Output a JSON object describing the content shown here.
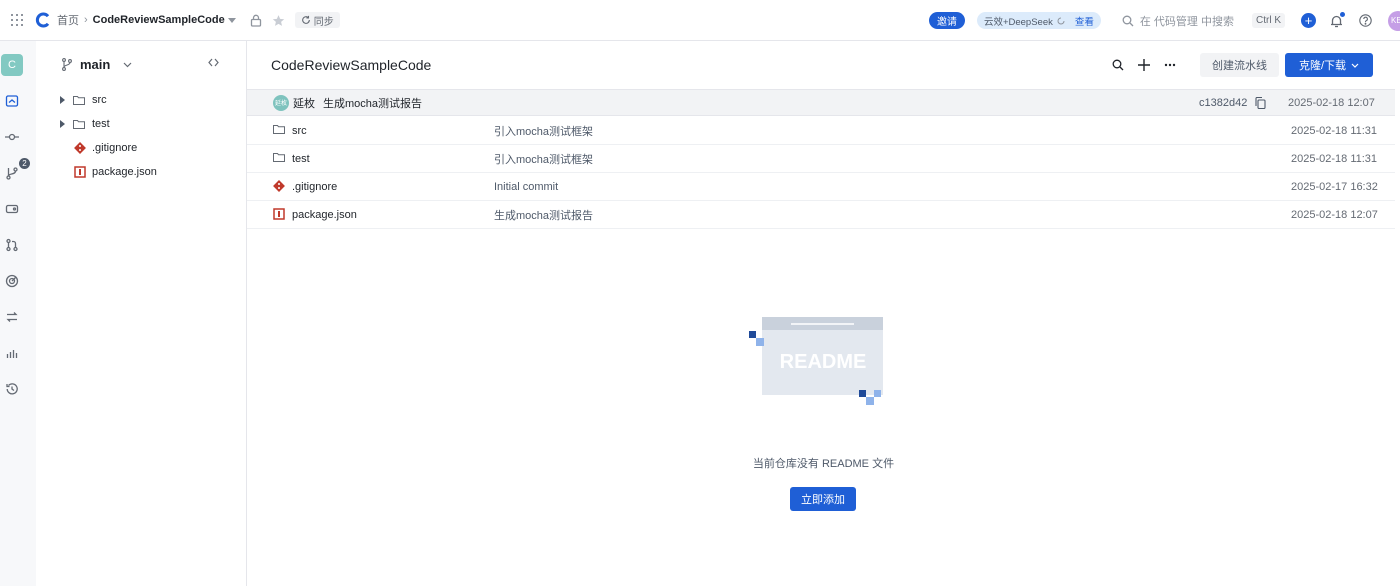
{
  "topbar": {
    "home": "首页",
    "repo": "CodeReviewSampleCode",
    "sync": "同步",
    "invite": "邀请",
    "ai_label": "云效+DeepSeek",
    "ai_view": "查看",
    "search_placeholder": "在 代码管理 中搜索",
    "shortcut": "Ctrl K",
    "avatar": "KE",
    "accent": "#1f5fd6"
  },
  "rail": {
    "repo_initial": "C",
    "merge_badge": "2",
    "icons": [
      "home-icon",
      "commit-icon",
      "branch-icon",
      "tag-icon",
      "merge-request-icon",
      "dashboard-icon",
      "compare-icon",
      "chart-icon",
      "history-icon"
    ]
  },
  "tree": {
    "branch": "main",
    "items": [
      {
        "name": "src",
        "type": "folder"
      },
      {
        "name": "test",
        "type": "folder"
      },
      {
        "name": ".gitignore",
        "type": "git"
      },
      {
        "name": "package.json",
        "type": "npm"
      }
    ]
  },
  "main": {
    "title": "CodeReviewSampleCode",
    "create_pipeline": "创建流水线",
    "clone_download": "克隆/下载",
    "last_commit": {
      "avatar": "延枚",
      "author": "延枚",
      "message": "生成mocha测试报告",
      "hash": "c1382d42",
      "time": "2025-02-18 12:07"
    },
    "files": [
      {
        "name": "src",
        "type": "folder",
        "message": "引入mocha测试框架",
        "time": "2025-02-18 11:31"
      },
      {
        "name": "test",
        "type": "folder",
        "message": "引入mocha测试框架",
        "time": "2025-02-18 11:31"
      },
      {
        "name": ".gitignore",
        "type": "git",
        "message": "Initial commit",
        "time": "2025-02-17 16:32"
      },
      {
        "name": "package.json",
        "type": "npm",
        "message": "生成mocha测试报告",
        "time": "2025-02-18 12:07"
      }
    ],
    "readme_illustration": "README",
    "empty_text": "当前仓库没有 README 文件",
    "add_button": "立即添加"
  }
}
